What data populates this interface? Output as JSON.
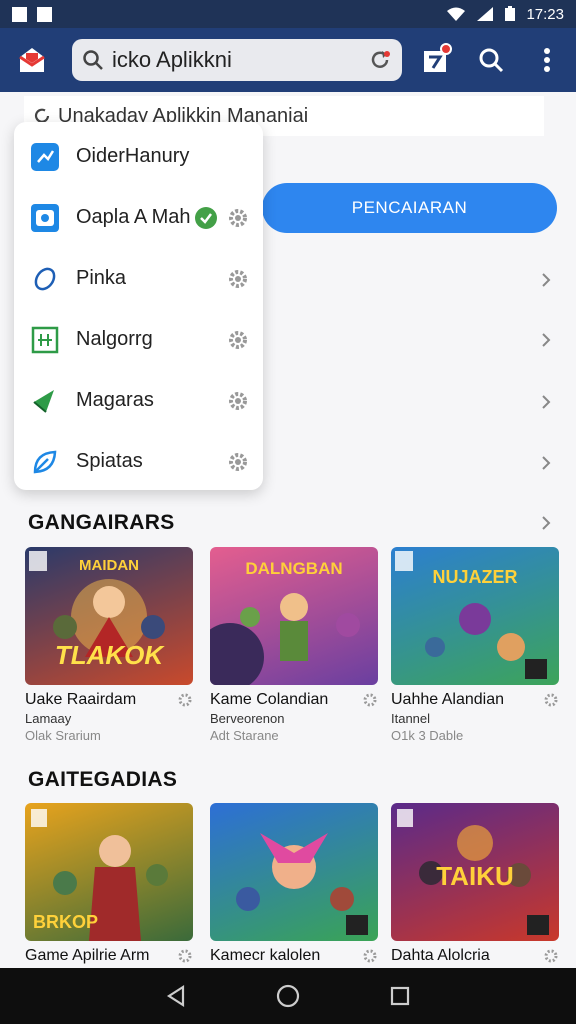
{
  "status": {
    "time": "17:23"
  },
  "search": {
    "value": "icko Aplikkni"
  },
  "subheader": {
    "text": "Unakaday Aplikkin Mananiai"
  },
  "primary_button": {
    "label": "PENCAIARAN"
  },
  "dropdown": {
    "items": [
      {
        "label": "OiderHanury",
        "icon": "tools-icon",
        "color": "#1e88e5"
      },
      {
        "label": "Oapla A Mah",
        "icon": "face-icon",
        "color": "#1e88e5",
        "checked": true
      },
      {
        "label": "Pinka",
        "icon": "ring-icon",
        "color": "#1e5fb5"
      },
      {
        "label": "Nalgorrg",
        "icon": "grid-icon",
        "color": "#2e9b47"
      },
      {
        "label": "Magaras",
        "icon": "flag-icon",
        "color": "#2e9b47"
      },
      {
        "label": "Spiatas",
        "icon": "leaf-icon",
        "color": "#1e88e5"
      }
    ]
  },
  "sections": [
    {
      "title": "GANGAIRARS",
      "cards": [
        {
          "title": "Uake Raairdam",
          "subtitle": "Lamaay",
          "meta": "Olak Srarium",
          "art_text": "TLAKOK",
          "top": "MAIDAN",
          "c1": "#2a3a6a",
          "c2": "#c94a2c"
        },
        {
          "title": "Kame Colandian",
          "subtitle": "Berveorenon",
          "meta": "Adt Starane",
          "art_text": "",
          "top": "DALNGBAN",
          "c1": "#e45e8f",
          "c2": "#6a3fa0"
        },
        {
          "title": "Uahhe Alandian",
          "subtitle": "Itannel",
          "meta": "O1k 3 Dable",
          "art_text": "",
          "top": "NUJAZER",
          "c1": "#2c7fd0",
          "c2": "#3da45a"
        }
      ]
    },
    {
      "title": "GAITEGADIAS",
      "cards": [
        {
          "title": "Game Apilrie Arm",
          "subtitle": "",
          "meta": "",
          "art_text": "BRKOP",
          "top": "",
          "c1": "#e8a31d",
          "c2": "#3a6a3a"
        },
        {
          "title": "Kamecr kalolen",
          "subtitle": "",
          "meta": "",
          "art_text": "",
          "top": "",
          "c1": "#2d6fd6",
          "c2": "#3aa455"
        },
        {
          "title": "Dahta Alolcria",
          "subtitle": "",
          "meta": "",
          "art_text": "TAIKU",
          "top": "",
          "c1": "#5a2a8a",
          "c2": "#c9382a"
        }
      ]
    }
  ]
}
